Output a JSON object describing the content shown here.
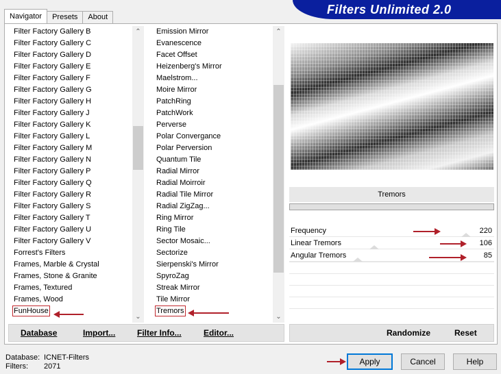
{
  "tabs": [
    "Navigator",
    "Presets",
    "About"
  ],
  "banner": "Filters Unlimited 2.0",
  "categories": [
    "Filter Factory Gallery B",
    "Filter Factory Gallery C",
    "Filter Factory Gallery D",
    "Filter Factory Gallery E",
    "Filter Factory Gallery F",
    "Filter Factory Gallery G",
    "Filter Factory Gallery H",
    "Filter Factory Gallery J",
    "Filter Factory Gallery K",
    "Filter Factory Gallery L",
    "Filter Factory Gallery M",
    "Filter Factory Gallery N",
    "Filter Factory Gallery P",
    "Filter Factory Gallery Q",
    "Filter Factory Gallery R",
    "Filter Factory Gallery S",
    "Filter Factory Gallery T",
    "Filter Factory Gallery U",
    "Filter Factory Gallery V",
    "Forrest's Filters",
    "Frames, Marble & Crystal",
    "Frames, Stone & Granite",
    "Frames, Textured",
    "Frames, Wood",
    "FunHouse"
  ],
  "filters": [
    "Emission Mirror",
    "Evanescence",
    "Facet Offset",
    "Heizenberg's Mirror",
    "Maelstrom...",
    "Moire Mirror",
    "PatchRing",
    "PatchWork",
    "Perverse",
    "Polar Convergance",
    "Polar Perversion",
    "Quantum Tile",
    "Radial Mirror",
    "Radial Moirroir",
    "Radial Tile Mirror",
    "Radial ZigZag...",
    "Ring Mirror",
    "Ring Tile",
    "Sector Mosaic...",
    "Sectorize",
    "Sierpenski's Mirror",
    "SpyroZag",
    "Streak Mirror",
    "Tile Mirror",
    "Tremors"
  ],
  "left_buttons": {
    "database": "Database",
    "import": "Import...",
    "filter_info": "Filter Info...",
    "editor": "Editor..."
  },
  "right_buttons": {
    "randomize": "Randomize",
    "reset": "Reset"
  },
  "filter_name": "Tremors",
  "params": [
    {
      "label": "Frequency",
      "value": "220",
      "level": 220
    },
    {
      "label": "Linear Tremors",
      "value": "106",
      "level": 106
    },
    {
      "label": "Angular Tremors",
      "value": "85",
      "level": 85
    }
  ],
  "status": {
    "database_label": "Database:",
    "database_value": "ICNET-Filters",
    "filters_label": "Filters:",
    "filters_value": "2071"
  },
  "dialog_buttons": {
    "apply": "Apply",
    "cancel": "Cancel",
    "help": "Help"
  },
  "annotation_color": "#b0202a"
}
